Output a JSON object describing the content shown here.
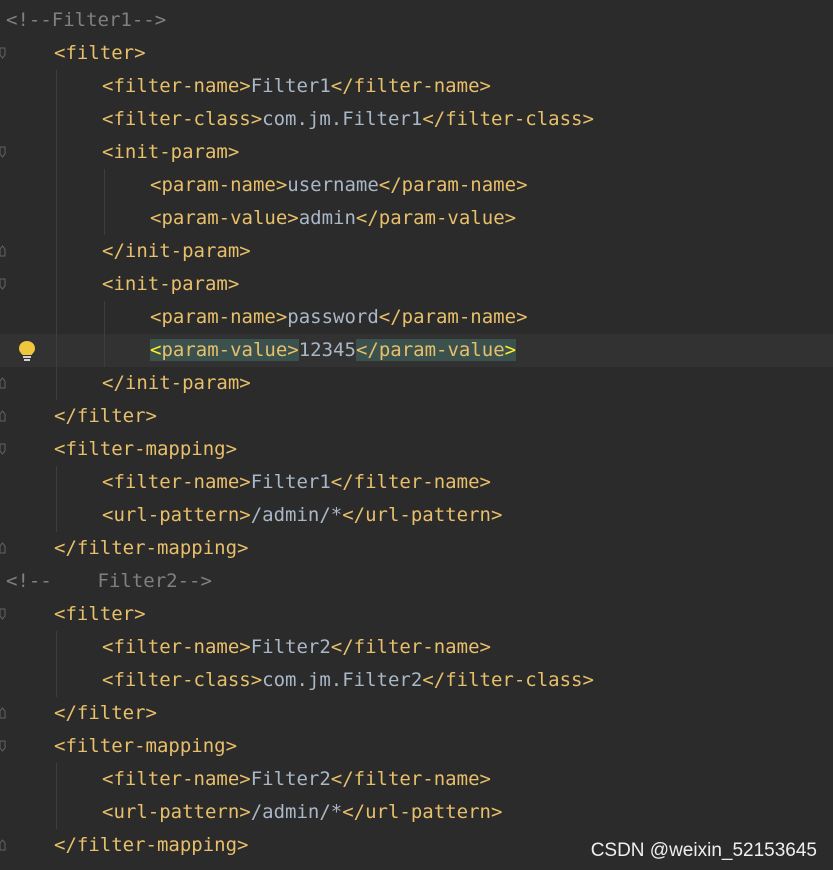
{
  "editor": {
    "colors": {
      "background": "#2b2b2b",
      "tag": "#e8bf6a",
      "text": "#a9b7c6",
      "comment": "#808080",
      "match_highlight": "#3b514d",
      "bulb": "#f0c63c"
    },
    "current_line": 10,
    "lines": [
      {
        "indent": 0,
        "fold": "none",
        "tokens": [
          {
            "t": "<!--Filter1-->",
            "c": "cmt"
          }
        ]
      },
      {
        "indent": 1,
        "fold": "open",
        "tokens": [
          {
            "t": "<filter>",
            "c": "tag"
          }
        ]
      },
      {
        "indent": 2,
        "fold": "none",
        "tokens": [
          {
            "t": "<filter-name>",
            "c": "tag"
          },
          {
            "t": "Filter1",
            "c": "txt"
          },
          {
            "t": "</filter-name>",
            "c": "tag"
          }
        ]
      },
      {
        "indent": 2,
        "fold": "none",
        "tokens": [
          {
            "t": "<filter-class>",
            "c": "tag"
          },
          {
            "t": "com.jm.Filter1",
            "c": "txt"
          },
          {
            "t": "</filter-class>",
            "c": "tag"
          }
        ]
      },
      {
        "indent": 2,
        "fold": "open",
        "tokens": [
          {
            "t": "<init-param>",
            "c": "tag"
          }
        ]
      },
      {
        "indent": 3,
        "fold": "none",
        "tokens": [
          {
            "t": "<param-name>",
            "c": "tag"
          },
          {
            "t": "username",
            "c": "txt"
          },
          {
            "t": "</param-name>",
            "c": "tag"
          }
        ]
      },
      {
        "indent": 3,
        "fold": "none",
        "tokens": [
          {
            "t": "<param-value>",
            "c": "tag"
          },
          {
            "t": "admin",
            "c": "txt"
          },
          {
            "t": "</param-value>",
            "c": "tag"
          }
        ]
      },
      {
        "indent": 2,
        "fold": "close",
        "tokens": [
          {
            "t": "</init-param>",
            "c": "tag"
          }
        ]
      },
      {
        "indent": 2,
        "fold": "open",
        "tokens": [
          {
            "t": "<init-param>",
            "c": "tag"
          }
        ]
      },
      {
        "indent": 3,
        "fold": "none",
        "tokens": [
          {
            "t": "<param-name>",
            "c": "tag"
          },
          {
            "t": "password",
            "c": "txt"
          },
          {
            "t": "</param-name>",
            "c": "tag"
          }
        ]
      },
      {
        "indent": 3,
        "fold": "none",
        "bulb": true,
        "tokens": [
          {
            "t": "<",
            "c": "tag",
            "hlEnd": true,
            "hl": true
          },
          {
            "t": "param-value>",
            "c": "tag",
            "hl": true
          },
          {
            "t": "12345",
            "c": "txt"
          },
          {
            "t": "</param-value",
            "c": "tag",
            "hl": true
          },
          {
            "t": ">",
            "c": "tag",
            "hlEnd": true,
            "hl": true
          }
        ]
      },
      {
        "indent": 2,
        "fold": "close",
        "tokens": [
          {
            "t": "</init-param>",
            "c": "tag"
          }
        ]
      },
      {
        "indent": 1,
        "fold": "close",
        "tokens": [
          {
            "t": "</filter>",
            "c": "tag"
          }
        ]
      },
      {
        "indent": 1,
        "fold": "open",
        "tokens": [
          {
            "t": "<filter-mapping>",
            "c": "tag"
          }
        ]
      },
      {
        "indent": 2,
        "fold": "none",
        "tokens": [
          {
            "t": "<filter-name>",
            "c": "tag"
          },
          {
            "t": "Filter1",
            "c": "txt"
          },
          {
            "t": "</filter-name>",
            "c": "tag"
          }
        ]
      },
      {
        "indent": 2,
        "fold": "none",
        "tokens": [
          {
            "t": "<url-pattern>",
            "c": "tag"
          },
          {
            "t": "/admin/*",
            "c": "txt"
          },
          {
            "t": "</url-pattern>",
            "c": "tag"
          }
        ]
      },
      {
        "indent": 1,
        "fold": "close",
        "tokens": [
          {
            "t": "</filter-mapping>",
            "c": "tag"
          }
        ]
      },
      {
        "indent": 0,
        "fold": "none",
        "tokens": [
          {
            "t": "<!--    Filter2-->",
            "c": "cmt"
          }
        ]
      },
      {
        "indent": 1,
        "fold": "open",
        "tokens": [
          {
            "t": "<filter>",
            "c": "tag"
          }
        ]
      },
      {
        "indent": 2,
        "fold": "none",
        "tokens": [
          {
            "t": "<filter-name>",
            "c": "tag"
          },
          {
            "t": "Filter2",
            "c": "txt"
          },
          {
            "t": "</filter-name>",
            "c": "tag"
          }
        ]
      },
      {
        "indent": 2,
        "fold": "none",
        "tokens": [
          {
            "t": "<filter-class>",
            "c": "tag"
          },
          {
            "t": "com.jm.Filter2",
            "c": "txt"
          },
          {
            "t": "</filter-class>",
            "c": "tag"
          }
        ]
      },
      {
        "indent": 1,
        "fold": "close",
        "tokens": [
          {
            "t": "</filter>",
            "c": "tag"
          }
        ]
      },
      {
        "indent": 1,
        "fold": "open",
        "tokens": [
          {
            "t": "<filter-mapping>",
            "c": "tag"
          }
        ]
      },
      {
        "indent": 2,
        "fold": "none",
        "tokens": [
          {
            "t": "<filter-name>",
            "c": "tag"
          },
          {
            "t": "Filter2",
            "c": "txt"
          },
          {
            "t": "</filter-name>",
            "c": "tag"
          }
        ]
      },
      {
        "indent": 2,
        "fold": "none",
        "tokens": [
          {
            "t": "<url-pattern>",
            "c": "tag"
          },
          {
            "t": "/admin/*",
            "c": "txt"
          },
          {
            "t": "</url-pattern>",
            "c": "tag"
          }
        ]
      },
      {
        "indent": 1,
        "fold": "close",
        "tokens": [
          {
            "t": "</filter-mapping>",
            "c": "tag"
          }
        ]
      }
    ]
  },
  "watermark": {
    "text": "CSDN @weixin_52153645"
  }
}
